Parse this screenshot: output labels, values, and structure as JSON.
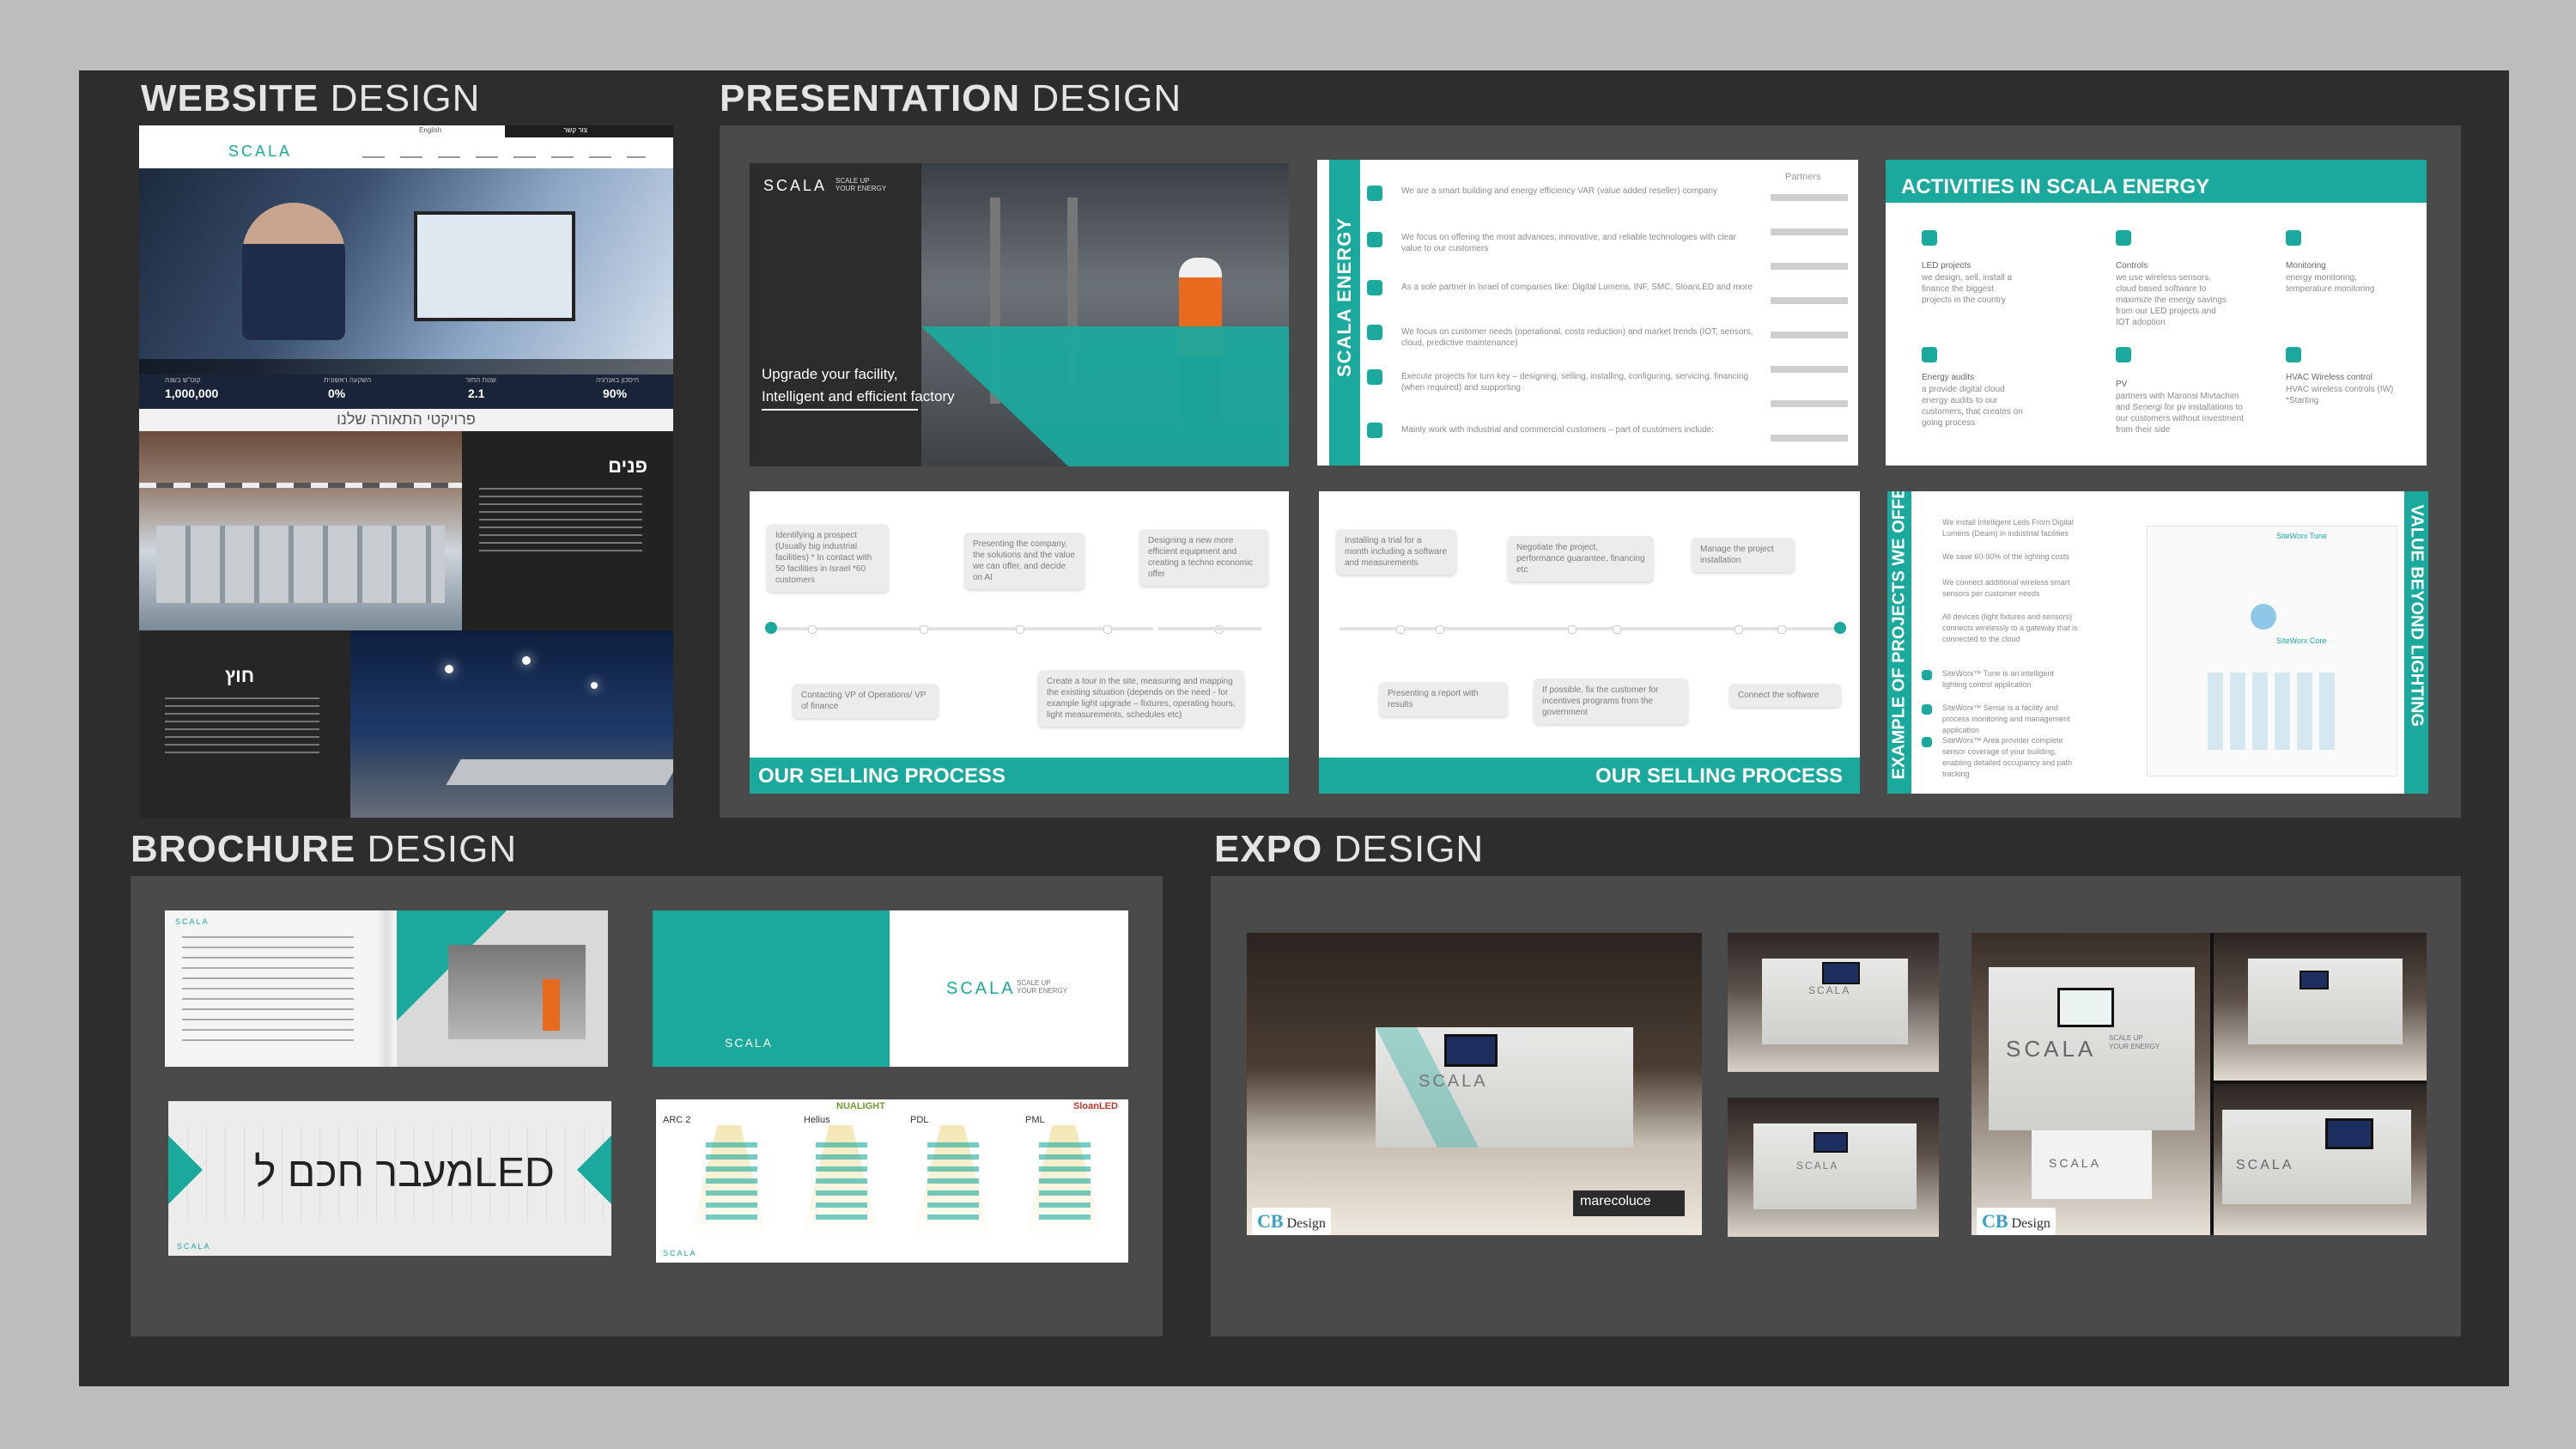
{
  "sections": {
    "website": {
      "bold": "WEBSITE",
      "light": " DESIGN"
    },
    "presentation": {
      "bold": "PRESENTATION",
      "light": " DESIGN"
    },
    "brochure": {
      "bold": "BROCHURE",
      "light": " DESIGN"
    },
    "expo": {
      "bold": "EXPO",
      "light": " DESIGN"
    }
  },
  "website": {
    "brand": "SCALA",
    "nav_buttons": [
      "English",
      "צור קשר"
    ],
    "stats": [
      {
        "value": "1,000,000",
        "label": "קוט\"ש בשנה"
      },
      {
        "value": "0%",
        "label": "השקעה ראשונית"
      },
      {
        "value": "2.1",
        "label": "שנות החזר"
      },
      {
        "value": "90%",
        "label": "חיסכון באנרגיה"
      }
    ],
    "projects_heading": "פרויקטי התאורה שלנו",
    "inside_heading": "פנים",
    "outside_heading": "חוץ"
  },
  "presentation": {
    "cover": {
      "brand": "SCALA",
      "tagline": "SCALE UP\nYOUR ENERGY",
      "line1": "Upgrade your facility,",
      "line2": "Intelligent and efficient factory"
    },
    "scala_energy": {
      "side_title": "SCALA ENERGY",
      "partner": "Partners",
      "bullets": [
        "We are a  smart building and energy efficiency  VAR (value added reseller) company",
        "We focus on offering the most advances, innovative, and reliable technologies with clear value to our customers",
        "As a sole partner in Israel of companies like: Digital Lumens, INF, SMC, SloanLED and more",
        "We focus on customer needs (operational, costs reduction) and market trends (IOT, sensors, cloud, predictive maintenance)",
        "Execute projects for turn key – designing, selling, installing, configuring, servicing, financing (when required) and supporting",
        "Mainly work with industrial and commercial customers – part of customers include:"
      ]
    },
    "activities": {
      "title": "ACTIVITIES IN SCALA ENERGY",
      "items": [
        {
          "title": "LED projects",
          "desc": "we design, sell, install a finance the biggest projects in the country"
        },
        {
          "title": "Controls",
          "desc": "we use wireless sensors, cloud based software to maximize the energy savings from our LED projects and IOT adoption"
        },
        {
          "title": "Monitoring",
          "desc": "energy monitoring, temperature monitoring"
        },
        {
          "title": "Energy audits",
          "desc": "a provide digital cloud energy audits to our customers, that creates on going process"
        },
        {
          "title": "PV",
          "desc": "partners with Maronsi Mivtachim and Senergi for pv installations to our customers without investment from their side"
        },
        {
          "title": "HVAC Wireless control",
          "desc": "HVAC wireless controls (IW) *Starting"
        }
      ]
    },
    "selling1": {
      "title": "OUR SELLING PROCESS",
      "top": [
        "Identifying a prospect (Usually big industrial facilities) * In contact with 50 facilities in Israel *60 customers",
        "Presenting the company, the solutions and the value we can offer, and decide on AI",
        "Designing a new more efficient equipment and creating a techno economic offer"
      ],
      "bottom": [
        "Contacting VP of Operations/ VP of finance",
        "Create a tour in the site, measuring and mapping the existing situation (depends on the need - for example light upgrade – fixtures, operating hours, light measurements, schedules etc)"
      ]
    },
    "selling2": {
      "title": "OUR SELLING PROCESS",
      "top": [
        "Installing a trial for a month including a software and measurements",
        "Negotiate the project, performance guarantee, financing etc",
        "Manage the project installation"
      ],
      "bottom": [
        "Presenting a report with results",
        "If possible, fix the customer for incentives programs from the government",
        "Connect the software"
      ]
    },
    "examples": {
      "left_title": "EXAMPLE OF PROJECTS WE OFFER",
      "right_title": "VALUE BEYOND LIGHTING",
      "bullets": [
        "We install Intelligent Leds From Digital Lumens (Deam) in industrial facilities",
        "We save 60-90% of the lighting costs",
        "We connect additional wireless smart sensors per customer needs",
        "All devices (light fixtures and sensors) connects wirelessly to a gateway that is connected to the cloud",
        "SiteWorx™ Tune is an intelligent lighting control application",
        "SiteWorx™ Sense is a facility and process monitoring and management application",
        "SiteWorx™ Area provider complete sensor coverage of your building, enabling detailed occupancy and path tracking"
      ],
      "diagram": [
        "SiteWorx Tune",
        "SiteWorx Core"
      ]
    }
  },
  "brochure": {
    "brand": "SCALA",
    "brand_tag": "SCALE UP\nYOUR ENERGY",
    "hebrew_title": "מעבר חכם לLED",
    "products": [
      "ARC 2",
      "Helius",
      "PDL",
      "PML"
    ],
    "product_brands": [
      "NUALIGHT",
      "SloanLED"
    ]
  },
  "expo": {
    "brand": "SCALA",
    "brand_tag": "SCALE UP\nYOUR ENERGY",
    "marecco": "marecoluce",
    "cb_logo": {
      "mark": "CB",
      "text": "Design"
    }
  },
  "colors": {
    "teal": "#1ba99d",
    "board": "#2d2d2d",
    "panel": "#4a4a4a"
  }
}
